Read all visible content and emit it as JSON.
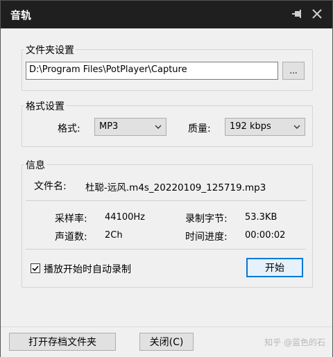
{
  "window": {
    "title": "音轨"
  },
  "folder": {
    "legend": "文件夹设置",
    "path": "D:\\Program Files\\PotPlayer\\Capture",
    "browse_label": "..."
  },
  "format": {
    "legend": "格式设置",
    "format_label": "格式:",
    "format_value": "MP3",
    "quality_label": "质量:",
    "quality_value": "192 kbps"
  },
  "info": {
    "legend": "信息",
    "filename_label": "文件名:",
    "filename_value": "杜聪-远风.m4s_20220109_125719.mp3",
    "sample_rate_label": "采样率:",
    "sample_rate_value": "44100Hz",
    "bytes_label": "录制字节:",
    "bytes_value": "53.3KB",
    "channels_label": "声道数:",
    "channels_value": "2Ch",
    "time_label": "时间进度:",
    "time_value": "00:00:02",
    "autorecord_label": "播放开始时自动录制",
    "autorecord_checked": true,
    "start_label": "开始"
  },
  "bottom": {
    "open_folder_label": "打开存档文件夹",
    "close_label": "关闭(C)",
    "watermark": "知乎 @蓝色的石"
  }
}
